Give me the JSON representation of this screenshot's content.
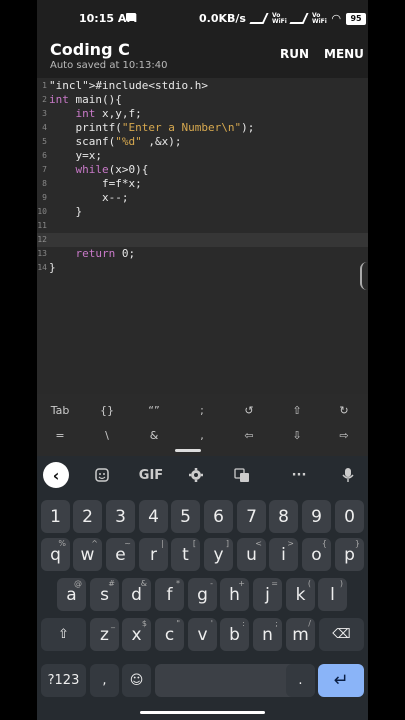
{
  "status": {
    "time": "10:15 AM",
    "speed": "0.0KB/s",
    "vo1": "Vo WiFi",
    "vo2": "Vo WiFi",
    "battery": "95"
  },
  "app": {
    "title": "Coding C",
    "subtitle": "Auto saved at 10:13:40",
    "run": "RUN",
    "menu": "MENU"
  },
  "editor": {
    "line_numbers": [
      "1",
      "2",
      "3",
      "4",
      "5",
      "6",
      "7",
      "8",
      "9",
      "10",
      "11",
      "12",
      "13",
      "14"
    ],
    "lines": [
      "#include<stdio.h>",
      "int main(){",
      "    int x,y,f;",
      "    printf(\"Enter a Number\\n\");",
      "    scanf(\"%d\" ,&x);",
      "    y=x;",
      "    while(x>0){",
      "        f=f*x;",
      "        x--;",
      "    }",
      "",
      "",
      "    return 0;",
      "}"
    ]
  },
  "symbols": {
    "row1": [
      "Tab",
      "{}",
      "“”",
      ";",
      "↺",
      "⇧",
      "↻"
    ],
    "row2": [
      "=",
      "\\",
      "&",
      ",",
      "⇦",
      "⇩",
      "⇨"
    ]
  },
  "toolbar": {
    "back": "‹",
    "gif": "GIF",
    "more": "···"
  },
  "keyboard": {
    "numbers": [
      "1",
      "2",
      "3",
      "4",
      "5",
      "6",
      "7",
      "8",
      "9",
      "0"
    ],
    "row1": [
      [
        "q",
        "%"
      ],
      [
        "w",
        "^"
      ],
      [
        "e",
        "~"
      ],
      [
        "r",
        "|"
      ],
      [
        "t",
        "["
      ],
      [
        "y",
        "]"
      ],
      [
        "u",
        "<"
      ],
      [
        "i",
        ">"
      ],
      [
        "o",
        "{"
      ],
      [
        "p",
        "}"
      ]
    ],
    "row2": [
      [
        "a",
        "@"
      ],
      [
        "s",
        "#"
      ],
      [
        "d",
        "&"
      ],
      [
        "f",
        "*"
      ],
      [
        "g",
        "-"
      ],
      [
        "h",
        "+"
      ],
      [
        "j",
        "="
      ],
      [
        "k",
        "("
      ],
      [
        "l",
        ")"
      ]
    ],
    "row3": [
      [
        "z",
        "_"
      ],
      [
        "x",
        "$"
      ],
      [
        "c",
        "\""
      ],
      [
        "v",
        "'"
      ],
      [
        "b",
        ":"
      ],
      [
        "n",
        ";"
      ],
      [
        "m",
        "/"
      ]
    ],
    "shift": "⇧",
    "backspace": "⌫",
    "sym": "?123",
    "comma": ",",
    "emoji": "☺",
    "period": ".",
    "enter": "↵"
  }
}
